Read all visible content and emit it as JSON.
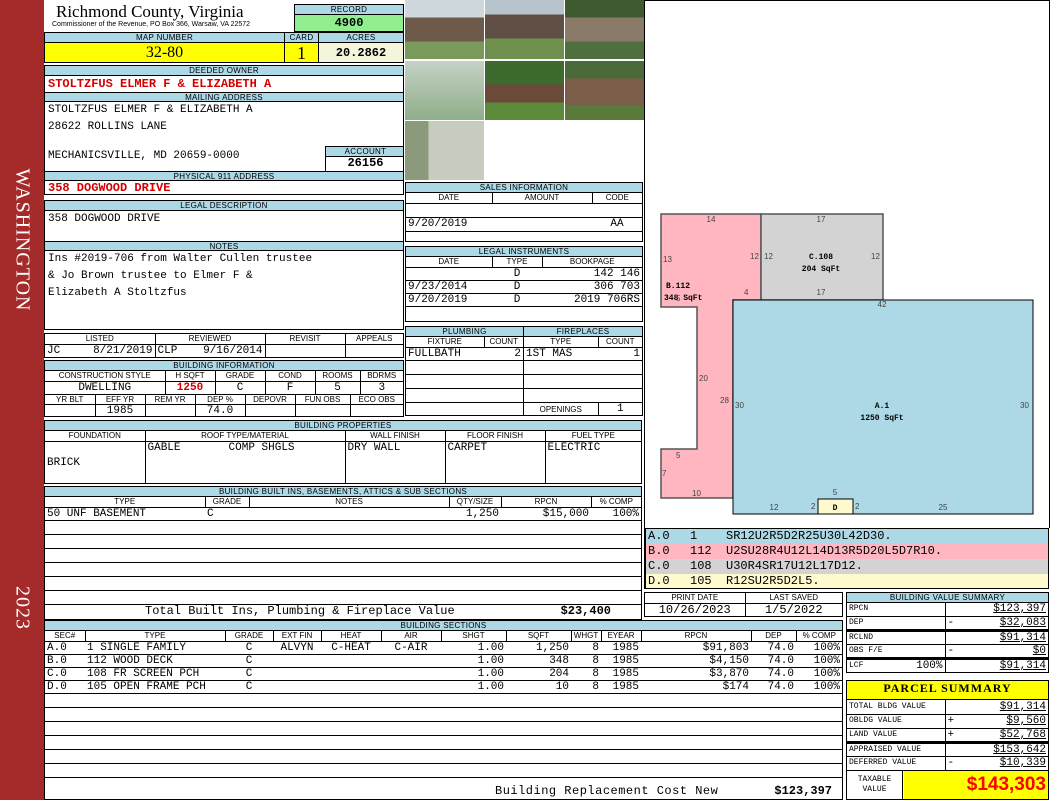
{
  "sidebar": {
    "district": "WASHINGTON",
    "year": "2023"
  },
  "header": {
    "title": "Richmond County, Virginia",
    "subtitle": "Commissioner of the Revenue, PO Box 366, Warsaw, VA 22572",
    "record_label": "RECORD",
    "record": "4900"
  },
  "parcel": {
    "map_label": "MAP NUMBER",
    "map": "32-80",
    "card_label": "CARD",
    "card": "1",
    "acres_label": "ACRES",
    "acres": "20.2862"
  },
  "owner": {
    "label": "DEEDED OWNER",
    "name": "STOLTZFUS ELMER F & ELIZABETH A"
  },
  "mailing": {
    "label": "MAILING ADDRESS",
    "line1": "STOLTZFUS ELMER F & ELIZABETH A",
    "line2": "28622 ROLLINS LANE",
    "line3": "MECHANICSVILLE, MD 20659-0000",
    "account_label": "ACCOUNT",
    "account": "26156"
  },
  "physical": {
    "label": "PHYSICAL 911 ADDRESS",
    "address": "358 DOGWOOD DRIVE"
  },
  "legal": {
    "label": "LEGAL DESCRIPTION",
    "text": "358 DOGWOOD DRIVE"
  },
  "notes": {
    "label": "NOTES",
    "line1": "Ins #2019-706 from Walter Cullen trustee",
    "line2": "& Jo Brown trustee to Elmer F &",
    "line3": "Elizabeth A Stoltzfus"
  },
  "review": {
    "listed_label": "LISTED",
    "listed_by": "JC",
    "listed_date": "8/21/2019",
    "reviewed_label": "REVIEWED",
    "reviewed_by": "CLP",
    "reviewed_date": "9/16/2014",
    "revisit_label": "REVISIT",
    "appeals_label": "APPEALS"
  },
  "building_info": {
    "label": "BUILDING INFORMATION",
    "headers": [
      "CONSTRUCTION STYLE",
      "H SQFT",
      "GRADE",
      "COND",
      "ROOMS",
      "BDRMS"
    ],
    "values": [
      "DWELLING",
      "1250",
      "C",
      "F",
      "5",
      "3"
    ],
    "headers2": [
      "YR BLT",
      "EFF YR",
      "REM YR",
      "DEP %",
      "DEPOVR",
      "FUN OBS",
      "ECO OBS"
    ],
    "values2": [
      "",
      "1985",
      "",
      "74.0",
      "",
      "",
      ""
    ]
  },
  "building_props": {
    "label": "BUILDING PROPERTIES",
    "headers": [
      "FOUNDATION",
      "ROOF TYPE/MATERIAL",
      "WALL FINISH",
      "FLOOR FINISH",
      "FUEL TYPE"
    ],
    "foundation": "BRICK",
    "roof_type": "GABLE",
    "roof_material": "COMP SHGLS",
    "wall": "DRY WALL",
    "floor": "CARPET",
    "fuel": "ELECTRIC"
  },
  "builtins": {
    "label": "BUILDING BUILT INS, BASEMENTS, ATTICS & SUB SECTIONS",
    "headers": [
      "TYPE",
      "GRADE",
      "NOTES",
      "QTY/SIZE",
      "RPCN",
      "% COMP"
    ],
    "rows": [
      [
        "50 UNF BASEMENT",
        "C",
        "",
        "1,250",
        "$15,000",
        "100%"
      ]
    ],
    "total_label": "Total Built Ins, Plumbing & Fireplace Value",
    "total": "$23,400"
  },
  "sections": {
    "label": "BUILDING SECTIONS",
    "headers": [
      "SEC#",
      "TYPE",
      "GRADE",
      "EXT FIN",
      "HEAT",
      "AIR",
      "SHGT",
      "SQFT",
      "WHGT",
      "EYEAR",
      "RPCN",
      "DEP",
      "% COMP"
    ],
    "rows": [
      [
        "A.0",
        "1 SINGLE FAMILY",
        "C",
        "ALVYN",
        "C-HEAT",
        "C-AIR",
        "1.00",
        "1,250",
        "8",
        "1985",
        "$91,803",
        "74.0",
        "100%"
      ],
      [
        "B.0",
        "112 WOOD DECK",
        "C",
        "",
        "",
        "",
        "1.00",
        "348",
        "8",
        "1985",
        "$4,150",
        "74.0",
        "100%"
      ],
      [
        "C.0",
        "108 FR SCREEN PCH",
        "C",
        "",
        "",
        "",
        "1.00",
        "204",
        "8",
        "1985",
        "$3,870",
        "74.0",
        "100%"
      ],
      [
        "D.0",
        "105 OPEN FRAME PCH",
        "C",
        "",
        "",
        "",
        "1.00",
        "10",
        "8",
        "1985",
        "$174",
        "74.0",
        "100%"
      ]
    ],
    "total_label": "Building Replacement Cost New",
    "total": "$123,397"
  },
  "sales": {
    "label": "SALES INFORMATION",
    "headers": [
      "DATE",
      "AMOUNT",
      "CODE"
    ],
    "rows": [
      [
        "",
        "",
        ""
      ],
      [
        "9/20/2019",
        "",
        "AA"
      ],
      [
        "",
        "",
        ""
      ]
    ]
  },
  "instruments": {
    "label": "LEGAL INSTRUMENTS",
    "headers": [
      "DATE",
      "TYPE",
      "BOOKPAGE"
    ],
    "rows": [
      [
        "",
        "D",
        "142 146"
      ],
      [
        "9/23/2014",
        "D",
        "306 703"
      ],
      [
        "9/20/2019",
        "D",
        "2019 706RS"
      ],
      [
        "",
        "",
        ""
      ]
    ]
  },
  "plumbing": {
    "label": "PLUMBING",
    "headers": [
      "FIXTURE",
      "COUNT"
    ],
    "rows": [
      [
        "FULLBATH",
        "2"
      ]
    ]
  },
  "fireplaces": {
    "label": "FIREPLACES",
    "headers": [
      "TYPE",
      "COUNT"
    ],
    "rows": [
      [
        "1ST MAS",
        "1"
      ]
    ],
    "openings_label": "OPENINGS",
    "openings": "1"
  },
  "sketch": {
    "labels": [
      "B.112",
      "348 SqFt",
      "C.108",
      "204 SqFt",
      "A.1",
      "1250 SqFt",
      "D"
    ],
    "dims": [
      "14",
      "13",
      "12",
      "4",
      "5",
      "20",
      "28",
      "5",
      "7",
      "10",
      "17",
      "12",
      "12",
      "17",
      "42",
      "30",
      "30",
      "5",
      "12",
      "2",
      "2",
      "25"
    ],
    "colors": {
      "A": "#add8e6",
      "B": "#ffb6c1",
      "C": "#d3d3d3",
      "D": "#fffacd"
    }
  },
  "vectors": [
    [
      "A.0",
      "1",
      "SR12U2R5D2R25U30L42D30."
    ],
    [
      "B.0",
      "112",
      "U2SU28R4U12L14D13R5D20L5D7R10."
    ],
    [
      "C.0",
      "108",
      "U30R4SR17U12L17D12."
    ],
    [
      "D.0",
      "105",
      "R12SU2R5D2L5."
    ]
  ],
  "dates": {
    "print_label": "PRINT DATE",
    "print": "10/26/2023",
    "saved_label": "LAST SAVED",
    "saved": "1/5/2022"
  },
  "value_summary": {
    "label": "BUILDING VALUE SUMMARY",
    "rows": [
      [
        "RPCN",
        "",
        "",
        "$123,397"
      ],
      [
        "DEP",
        "",
        "-",
        "$32,083"
      ],
      [
        "RCLND",
        "",
        "",
        "$91,314"
      ],
      [
        "OBS F/E",
        "",
        "-",
        "$0"
      ],
      [
        "LCF",
        "100%",
        "",
        "$91,314"
      ]
    ]
  },
  "parcel_summary": {
    "label": "PARCEL SUMMARY",
    "rows": [
      [
        "TOTAL BLDG VALUE",
        "",
        "$91,314"
      ],
      [
        "OBLDG VALUE",
        "+",
        "$9,560"
      ],
      [
        "LAND VALUE",
        "+",
        "$52,768"
      ],
      [
        "APPRAISED VALUE",
        "",
        "$153,642"
      ],
      [
        "DEFERRED VALUE",
        "-",
        "$10,339"
      ]
    ],
    "taxable_label_1": "TAXABLE",
    "taxable_label_2": "VALUE",
    "taxable": "$143,303"
  }
}
